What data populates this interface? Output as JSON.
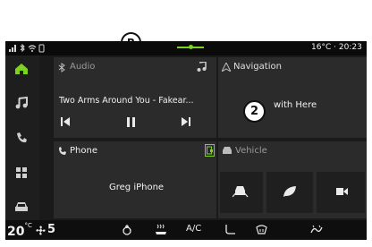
{
  "status_bar": {
    "icons_left": [
      "signal-icon",
      "bluetooth-icon",
      "wifi-icon",
      "sim-icon"
    ],
    "temperature": "16°C",
    "separator": "·",
    "time": "20:23"
  },
  "annotations": {
    "callout_b": "B",
    "callout_2": "2"
  },
  "sidebar": {
    "items": [
      {
        "icon": "home-icon",
        "active": true
      },
      {
        "icon": "music-icon",
        "active": false
      },
      {
        "icon": "phone-icon",
        "active": false
      },
      {
        "icon": "apps-grid-icon",
        "active": false
      },
      {
        "icon": "car-icon",
        "active": false
      }
    ]
  },
  "widgets": {
    "audio": {
      "title": "Audio",
      "track": "Two Arms Around You - Fakear..."
    },
    "navigation": {
      "title": "Navigation",
      "subtitle": "with Here"
    },
    "phone": {
      "title": "Phone",
      "device": "Greg iPhone"
    },
    "vehicle": {
      "title": "Vehicle"
    }
  },
  "bottom_bar": {
    "temperature": "20",
    "temperature_unit": "°C",
    "fan_level": "5",
    "ac_label": "A/C"
  },
  "colors": {
    "accent": "#7ed321",
    "background": "#1a1a1a",
    "panel": "#2b2b2b"
  }
}
